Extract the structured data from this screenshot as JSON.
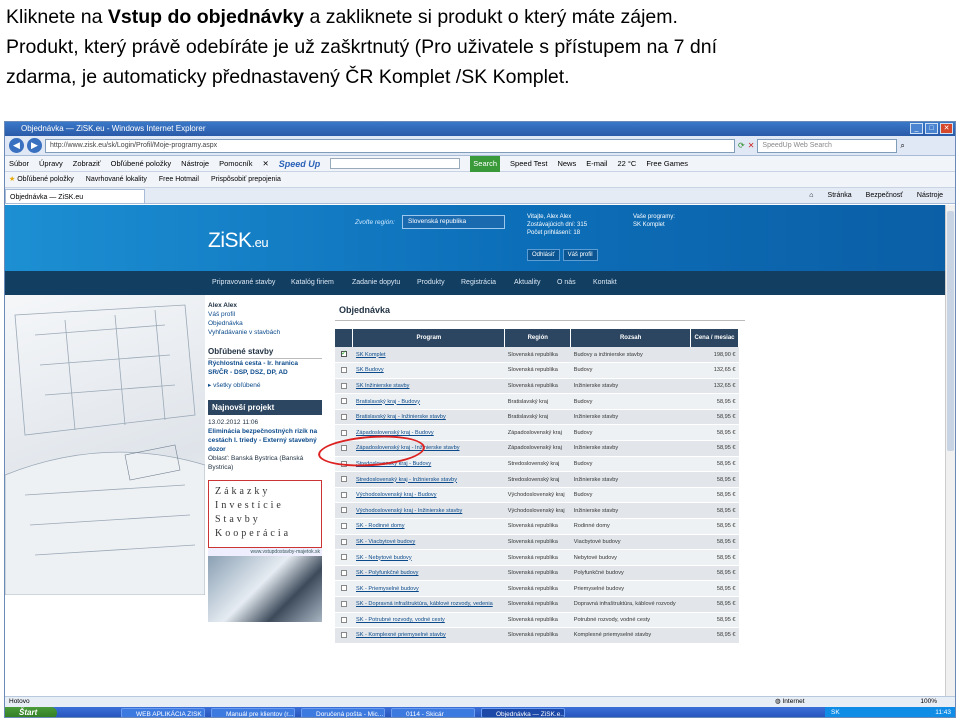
{
  "caption": {
    "pre": "Kliknete na ",
    "bold": "Vstup do objednávky",
    "post": " a zakliknete si produkt o který máte zájem.",
    "line2": "Produkt, který právě odebíráte je už zaškrtnutý (Pro uživatele s přístupem na 7 dní",
    "line3": "zdarma, je automaticky přednastavený ČR Komplet /SK Komplet."
  },
  "browser": {
    "title": "Objednávka — ZiSK.eu - Windows Internet Explorer",
    "url": "http://www.zisk.eu/sk/Login/Profil/Moje-programy.aspx",
    "search_placeholder": "SpeedUp Web Search",
    "menu": [
      "Súbor",
      "Úpravy",
      "Zobraziť",
      "Obľúbené položky",
      "Nástroje",
      "Pomocník"
    ],
    "speedup": "Speed Up",
    "toolbar_right": [
      "Search",
      "Speed Test",
      "News",
      "E-mail",
      "22 °C",
      "Free Games"
    ],
    "favorites": [
      "Obľúbené položky",
      "Navrhované lokality",
      "Free Hotmail",
      "Prispôsobiť prepojenia"
    ],
    "tab": "Objednávka — ZiSK.eu",
    "tab_tools": [
      "Stránka",
      "Bezpečnosť",
      "Nástroje"
    ],
    "status_left": "Hotovo",
    "status_zone": "Internet",
    "zoom": "100%"
  },
  "site": {
    "logo_main": "ZiSK",
    "logo_tld": ".eu",
    "region_label": "Zvoľte región:",
    "region_value": "Slovenská republika",
    "user_lines": [
      "Vitajte, Alex Alex",
      "Zostávajúcich dní: 315",
      "Počet prihlásení: 18"
    ],
    "user_buttons": [
      "Odhlásiť",
      "Váš profil"
    ],
    "program_lines": [
      "Vaše programy:",
      "SK Komplet"
    ],
    "nav": [
      "Pripravované stavby",
      "Katalóg firiem",
      "Zadanie dopytu",
      "Produkty",
      "Registrácia",
      "Aktuality",
      "O nás",
      "Kontakt"
    ]
  },
  "sidebar": {
    "user": "Alex Alex",
    "links": [
      "Váš profil",
      "Objednávka",
      "Vyhľadávanie v stavbách"
    ],
    "fav_head": "Obľúbené stavby",
    "fav_item_1": "Rýchlostná cesta - Ir. hranica",
    "fav_item_2": "SR/ČR - DSP, DSZ, DP, AD",
    "fav_all": "všetky obľúbené",
    "news_head": "Najnovší projekt",
    "news_date": "13.02.2012 11:06",
    "news_text": "Eliminácia bezpečnostných rizík na cestách I. triedy - Externý stavebný dozor",
    "news_area": "Oblasť: Banská Bystrica (Banská Bystrica)",
    "brand_lines": [
      "Zákazky",
      "Investície",
      "Stavby",
      "Kooperácia"
    ],
    "photo_caption": "www.vstupdostavby-majetok.sk"
  },
  "content": {
    "heading": "Objednávka",
    "columns": [
      "",
      "Program",
      "Región",
      "Rozsah",
      "Cena / mesiac"
    ],
    "rows": [
      {
        "checked": true,
        "program": "SK Komplet",
        "region": "Slovenská republika",
        "scope": "Budovy a inžinierske stavby",
        "price": "198,90 €"
      },
      {
        "checked": false,
        "program": "SK Budovy",
        "region": "Slovenská republika",
        "scope": "Budovy",
        "price": "132,65 €"
      },
      {
        "checked": false,
        "program": "SK Inžinierske stavby",
        "region": "Slovenská republika",
        "scope": "Inžinierske stavby",
        "price": "132,65 €"
      },
      {
        "checked": false,
        "program": "Bratislavský kraj - Budovy",
        "region": "Bratislavský kraj",
        "scope": "Budovy",
        "price": "58,95 €"
      },
      {
        "checked": false,
        "program": "Bratislavský kraj - Inžinierske stavby",
        "region": "Bratislavský kraj",
        "scope": "Inžinierske stavby",
        "price": "58,95 €"
      },
      {
        "checked": false,
        "program": "Západoslovenský kraj - Budovy",
        "region": "Západoslovenský kraj",
        "scope": "Budovy",
        "price": "58,95 €"
      },
      {
        "checked": false,
        "program": "Západoslovenský kraj - Inžinierske stavby",
        "region": "Západoslovenský kraj",
        "scope": "Inžinierske stavby",
        "price": "58,95 €"
      },
      {
        "checked": false,
        "program": "Stredoslovenský kraj - Budovy",
        "region": "Stredoslovenský kraj",
        "scope": "Budovy",
        "price": "58,95 €"
      },
      {
        "checked": false,
        "program": "Stredoslovenský kraj - Inžinierske stavby",
        "region": "Stredoslovenský kraj",
        "scope": "Inžinierske stavby",
        "price": "58,95 €"
      },
      {
        "checked": false,
        "program": "Východoslovenský kraj - Budovy",
        "region": "Východoslovenský kraj",
        "scope": "Budovy",
        "price": "58,95 €"
      },
      {
        "checked": false,
        "program": "Východoslovenský kraj - Inžinierske stavby",
        "region": "Východoslovenský kraj",
        "scope": "Inžinierske stavby",
        "price": "58,95 €"
      },
      {
        "checked": false,
        "program": "SK - Rodinné domy",
        "region": "Slovenská republika",
        "scope": "Rodinné domy",
        "price": "58,95 €"
      },
      {
        "checked": false,
        "program": "SK - Viacbytové budovy",
        "region": "Slovenská republika",
        "scope": "Viacbytové budovy",
        "price": "58,95 €"
      },
      {
        "checked": false,
        "program": "SK - Nebytové budovy",
        "region": "Slovenská republika",
        "scope": "Nebytové budovy",
        "price": "58,95 €"
      },
      {
        "checked": false,
        "program": "SK - Polyfunkčné budovy",
        "region": "Slovenská republika",
        "scope": "Polyfunkčné budovy",
        "price": "58,95 €"
      },
      {
        "checked": false,
        "program": "SK - Priemyselné budovy",
        "region": "Slovenská republika",
        "scope": "Priemyselné budovy",
        "price": "58,95 €"
      },
      {
        "checked": false,
        "program": "SK - Dopravná infraštruktúra, káblové rozvody, vedenia",
        "region": "Slovenská republika",
        "scope": "Dopravná infraštruktúra, káblové rozvody",
        "price": "58,95 €"
      },
      {
        "checked": false,
        "program": "SK - Potrubné rozvody, vodné cesty",
        "region": "Slovenská republika",
        "scope": "Potrubné rozvody, vodné cesty",
        "price": "58,95 €"
      },
      {
        "checked": false,
        "program": "SK - Komplexné priemyselné stavby",
        "region": "Slovenská republika",
        "scope": "Komplexné priemyselné stavby",
        "price": "58,95 €"
      }
    ]
  },
  "taskbar": {
    "start": "Štart",
    "items": [
      "WEB APLIKÁCIA ZISK ...",
      "Manuál pre klientov (r...",
      "Doručená pošta - Mic...",
      "0114 - Skicár",
      "Objednávka — ZiSK.e..."
    ],
    "lang": "SK",
    "clock": "11:43"
  }
}
